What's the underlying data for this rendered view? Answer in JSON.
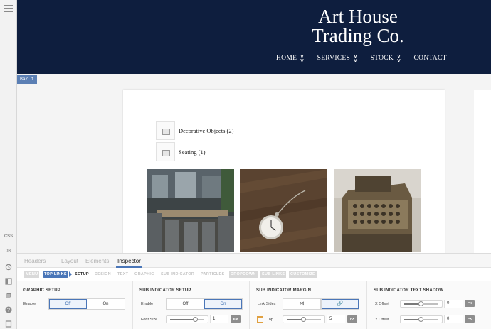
{
  "left_toolbar": {
    "labels": [
      "CSS",
      "JS"
    ],
    "icons": [
      "menu-icon",
      "history-icon",
      "panel-icon",
      "library-icon",
      "help-icon",
      "export-icon"
    ]
  },
  "site": {
    "brand_line1": "Art House",
    "brand_line2": "Trading Co.",
    "nav": [
      {
        "label": "HOME",
        "dropdown": true
      },
      {
        "label": "SERVICES",
        "dropdown": true
      },
      {
        "label": "STOCK",
        "dropdown": true
      },
      {
        "label": "CONTACT",
        "dropdown": false
      }
    ],
    "bar_tag": "Bar 1",
    "categories": [
      "Decorative Objects (2)",
      "Seating (1)"
    ],
    "photos": [
      "dining-chairs-photo",
      "pocket-watch-photo",
      "cash-register-photo"
    ]
  },
  "inspector": {
    "tabs": [
      "Headers",
      "Layout",
      "Elements",
      "Inspector"
    ],
    "active_tab": "Inspector",
    "subtabs": [
      "MENU",
      "TOP LINKS",
      "SETUP",
      "DESIGN",
      "TEXT",
      "GRAPHIC",
      "SUB INDICATOR",
      "PARTICLES",
      "DROPDOWN",
      "SUB LINKS",
      "CUSTOMIZE"
    ],
    "active_subtab": "SETUP",
    "graphic_setup": {
      "title": "GRAPHIC SETUP",
      "enable_label": "Enable",
      "off": "Off",
      "on": "On",
      "selected": "Off"
    },
    "sub_indicator_setup": {
      "title": "SUB INDICATOR SETUP",
      "enable_label": "Enable",
      "off": "Off",
      "on": "On",
      "selected": "On",
      "font_size_label": "Font Size",
      "font_size_value": "1",
      "font_size_unit": "EM",
      "font_size_level": 0.75
    },
    "sub_indicator_margin": {
      "title": "SUB INDICATOR MARGIN",
      "link_sides_label": "Link Sides",
      "top_label": "Top",
      "top_value": "5",
      "top_unit": "PX",
      "top_level": 0.5
    },
    "sub_indicator_text_shadow": {
      "title": "SUB INDICATOR TEXT SHADOW",
      "x_offset_label": "X Offset",
      "x_offset_value": "0",
      "x_offset_unit": "PX",
      "x_offset_level": 0.5,
      "y_offset_label": "Y Offset",
      "y_offset_value": "0",
      "y_offset_unit": "PX",
      "y_offset_level": 0.5
    }
  },
  "colors": {
    "header_bg": "#0e1e3e",
    "accent": "#4a76b8"
  }
}
